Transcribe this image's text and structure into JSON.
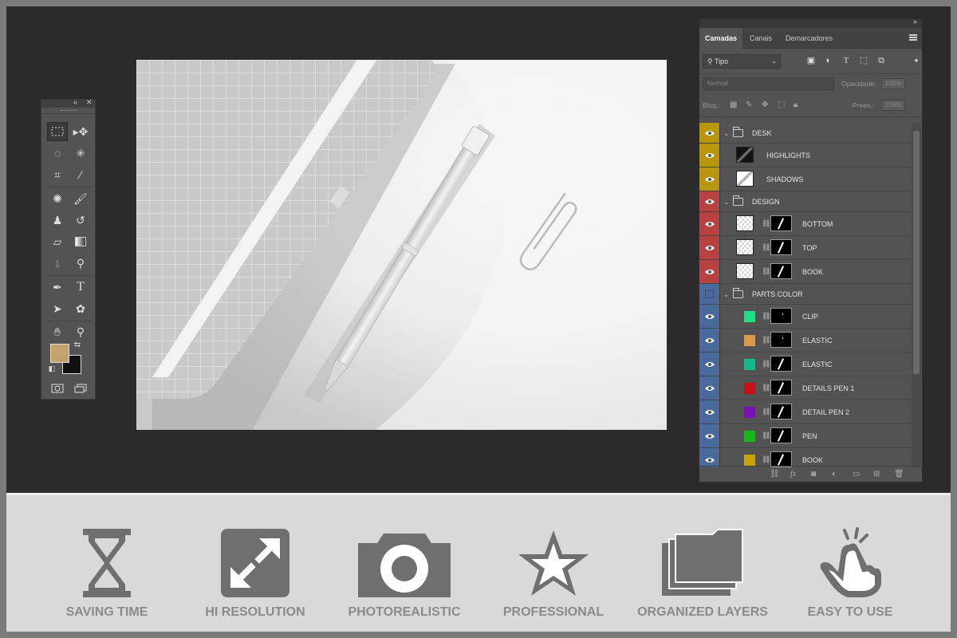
{
  "layers_panel": {
    "tabs": [
      "Camadas",
      "Canais",
      "Demarcadores"
    ],
    "filter_label": "Tipo",
    "blend_mode": "Normal",
    "opacity_label": "Opacidade:",
    "opacity_value": "100%",
    "lock_label": "Bloq.:",
    "fill_label": "Preen.:",
    "fill_value": "100%",
    "layers": [
      {
        "name": "DESK",
        "kind": "group",
        "color": "#b8950b"
      },
      {
        "name": "HIGHLIGHTS",
        "kind": "layer",
        "color": "#b8950b"
      },
      {
        "name": "SHADOWS",
        "kind": "layer",
        "color": "#b8950b"
      },
      {
        "name": "DESIGN",
        "kind": "group",
        "color": "#b84242"
      },
      {
        "name": "BOTTOM",
        "kind": "smart",
        "color": "#b84242"
      },
      {
        "name": "TOP",
        "kind": "smart",
        "color": "#b84242"
      },
      {
        "name": "BOOK",
        "kind": "smart",
        "color": "#b84242"
      },
      {
        "name": "PARTS COLOR",
        "kind": "group",
        "color": "#4a6a9e"
      },
      {
        "name": "CLIP",
        "kind": "fill",
        "color": "#4a6a9e",
        "swatch": "#1de086"
      },
      {
        "name": "ELASTIC",
        "kind": "fill",
        "color": "#4a6a9e",
        "swatch": "#d99a4e"
      },
      {
        "name": "ELASTIC",
        "kind": "fill",
        "color": "#4a6a9e",
        "swatch": "#14b88c"
      },
      {
        "name": "DETAILS PEN 1",
        "kind": "fill",
        "color": "#4a6a9e",
        "swatch": "#c8101a"
      },
      {
        "name": "DETAIL PEN 2",
        "kind": "fill",
        "color": "#4a6a9e",
        "swatch": "#7a10b8"
      },
      {
        "name": "PEN",
        "kind": "fill",
        "color": "#4a6a9e",
        "swatch": "#19b81a"
      },
      {
        "name": "BOOK",
        "kind": "fill",
        "color": "#4a6a9e",
        "swatch": "#c8a30c"
      }
    ]
  },
  "tools": {
    "foreground_color": "#c4a06c",
    "background_color": "#111111"
  },
  "features": [
    {
      "label": "SAVING TIME",
      "icon": "hourglass-icon"
    },
    {
      "label": "HI RESOLUTION",
      "icon": "expand-icon"
    },
    {
      "label": "PHOTOREALISTIC",
      "icon": "camera-icon"
    },
    {
      "label": "PROFESSIONAL",
      "icon": "star-icon"
    },
    {
      "label": "ORGANIZED LAYERS",
      "icon": "layers-icon"
    },
    {
      "label": "EASY TO USE",
      "icon": "hand-pointer-icon"
    }
  ]
}
